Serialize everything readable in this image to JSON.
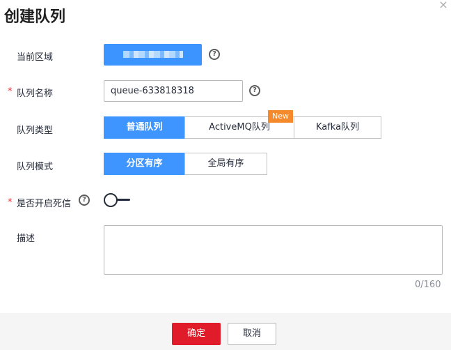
{
  "dialog": {
    "title": "创建队列",
    "close_icon": "×"
  },
  "form": {
    "region": {
      "label": "当前区域",
      "value": "",
      "help_icon": "?"
    },
    "queue_name": {
      "label": "队列名称",
      "required_mark": "*",
      "value": "queue-633818318",
      "help_icon": "?"
    },
    "queue_type": {
      "label": "队列类型",
      "options": [
        "普通队列",
        "ActiveMQ队列",
        "Kafka队列"
      ],
      "selected": "普通队列",
      "new_badge": "New"
    },
    "queue_mode": {
      "label": "队列模式",
      "options": [
        "分区有序",
        "全局有序"
      ],
      "selected": "分区有序"
    },
    "dead_letter": {
      "label": "是否开启死信",
      "required_mark": "*",
      "help_icon": "?",
      "enabled": false
    },
    "description": {
      "label": "描述",
      "value": "",
      "counter": "0/160"
    }
  },
  "footer": {
    "ok_label": "确定",
    "cancel_label": "取消"
  },
  "colors": {
    "primary": "#3e95ff",
    "danger": "#e01b2a",
    "badge": "#f48a2c"
  }
}
